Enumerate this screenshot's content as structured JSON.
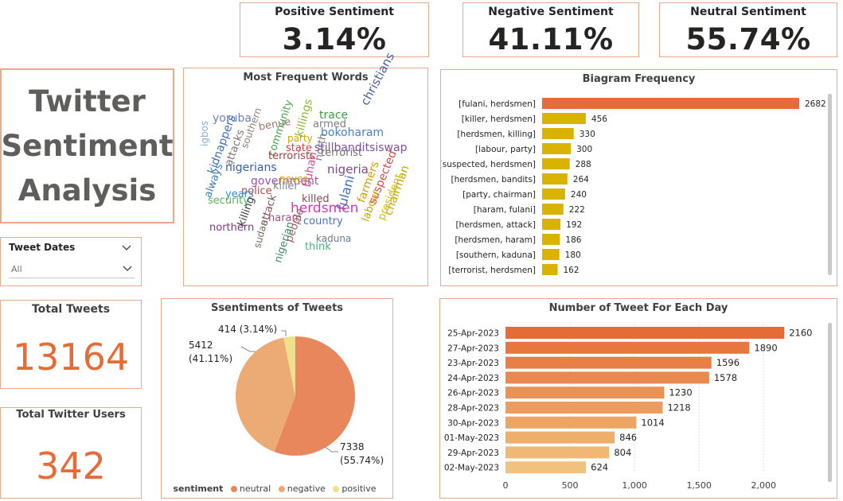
{
  "kpis": {
    "positive": {
      "label": "Positive Sentiment",
      "value": "3.14%"
    },
    "negative": {
      "label": "Negative Sentiment",
      "value": "41.11%"
    },
    "neutral": {
      "label": "Neutral Sentiment",
      "value": "55.74%"
    }
  },
  "title": {
    "line1": "Twitter",
    "line2": "Sentiment",
    "line3": "Analysis"
  },
  "slicer": {
    "label": "Tweet Dates",
    "value": "All"
  },
  "total_tweets": {
    "label": "Total Tweets",
    "value": "13164"
  },
  "total_users": {
    "label": "Total Twitter Users",
    "value": "342"
  },
  "colors": {
    "accent": "#e66c37",
    "border": "#e8a98a",
    "neutral": "#e8875b",
    "negative": "#ecaa75",
    "positive": "#f0e08c",
    "bigram_top": "#e66c37",
    "bigram_rest": "#d9b300"
  },
  "wordcloud": {
    "title": "Most Frequent Words",
    "words": [
      "yoruba",
      "igbos",
      "kidnappers",
      "always",
      "attacks",
      "southern",
      "benue",
      "community",
      "killings",
      "trace",
      "armed",
      "christians",
      "bokoharam",
      "stillbanditsiswap",
      "party",
      "state",
      "terrorists",
      "terrorist",
      "nigerians",
      "government",
      "north",
      "buhari",
      "nigeria",
      "killer",
      "never",
      "police",
      "killed",
      "fulani",
      "farmers",
      "suspected",
      "labour",
      "president",
      "chairman",
      "years",
      "security",
      "killing",
      "attack",
      "haram",
      "herdsmen",
      "country",
      "sudan",
      "people",
      "kaduna",
      "northern",
      "nigerian",
      "think"
    ]
  },
  "chart_data": [
    {
      "type": "bar",
      "title": "Biagram Frequency",
      "orientation": "horizontal",
      "categories": [
        "[fulani, herdsmen]",
        "[killer, herdsmen]",
        "[herdsmen, killing]",
        "[labour, party]",
        "[suspected, herdsmen]",
        "[herdsmen, bandits]",
        "[party, chairman]",
        "[haram, fulani]",
        "[herdsmen, attack]",
        "[herdsmen, haram]",
        "[southern, kaduna]",
        "[terrorist, herdsmen]"
      ],
      "values": [
        2682,
        456,
        330,
        300,
        288,
        264,
        240,
        222,
        192,
        186,
        180,
        162
      ],
      "data_labels": [
        "2682",
        "456",
        "330",
        "300",
        "288",
        "264",
        "240",
        "222",
        "192",
        "186",
        "180",
        "162"
      ],
      "xlim": [
        0,
        2682
      ]
    },
    {
      "type": "pie",
      "title": "Ssentiments of Tweets",
      "categories": [
        "neutral",
        "negative",
        "positive"
      ],
      "values": [
        7338,
        5412,
        414
      ],
      "percent_labels": [
        "(55.74%)",
        "(41.11%)",
        "(3.14%)"
      ],
      "value_labels": [
        "7338",
        "5412",
        "414 (3.14%)"
      ],
      "legend_title": "sentiment",
      "legend_position": "bottom"
    },
    {
      "type": "bar",
      "title": "Number of Tweet For Each Day",
      "orientation": "horizontal",
      "categories": [
        "25-Apr-2023",
        "27-Apr-2023",
        "23-Apr-2023",
        "24-Apr-2023",
        "26-Apr-2023",
        "28-Apr-2023",
        "30-Apr-2023",
        "01-May-2023",
        "29-Apr-2023",
        "02-May-2023"
      ],
      "values": [
        2160,
        1890,
        1596,
        1578,
        1230,
        1218,
        1014,
        846,
        804,
        624
      ],
      "data_labels": [
        "2160",
        "1890",
        "1596",
        "1578",
        "1230",
        "1218",
        "1014",
        "846",
        "804",
        "624"
      ],
      "xticks": [
        "0",
        "500",
        "1,000",
        "1,500",
        "2,000"
      ],
      "xlim": [
        0,
        2350
      ],
      "grid": true
    }
  ]
}
